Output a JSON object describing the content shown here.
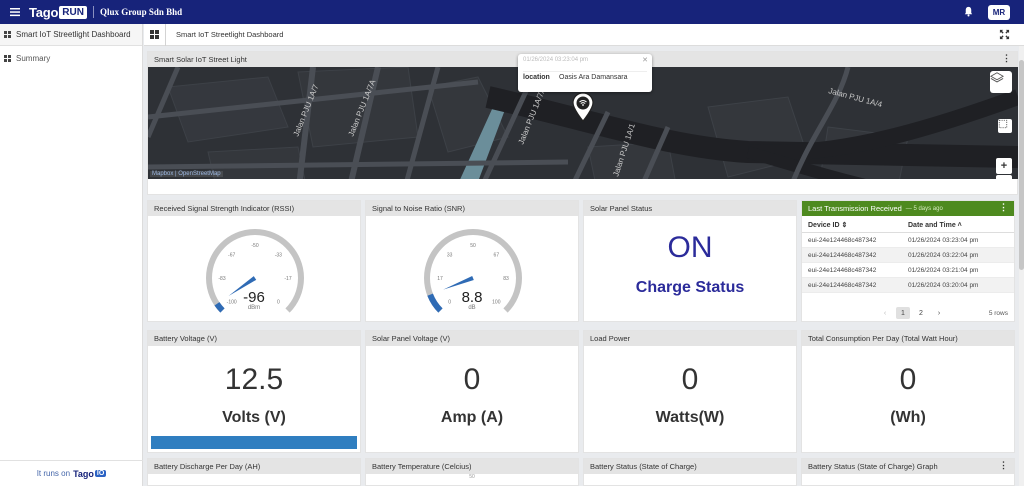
{
  "topbar": {
    "brand": "Tago",
    "brand_badge": "RUN",
    "company": "Qlux Group Sdn Bhd",
    "user_initials": "MR"
  },
  "sidebar": {
    "header": "Smart IoT Streetlight Dashboard",
    "items": [
      {
        "label": "Summary"
      }
    ],
    "footer_text": "It runs on",
    "footer_brand": "Tago",
    "footer_badge": "IO"
  },
  "dashboard": {
    "title": "Smart IoT Streetlight Dashboard"
  },
  "map_widget": {
    "title": "Smart Solar IoT Street Light",
    "popup": {
      "timestamp": "01/26/2024 03:23:04 pm",
      "key": "location",
      "value": "Oasis Ara Damansara"
    },
    "attribution_a": "Mapbox",
    "attribution_sep": "|",
    "attribution_b": "OpenStreetMap",
    "zoom_in": "+",
    "zoom_out": "−",
    "street_labels": [
      "Jalan PJU 1A/7",
      "Jalan PJU 1A/7A",
      "Jalan PJU 1A/7A",
      "Jalan PJU 1A/1",
      "Jalan PJU 1A/4"
    ]
  },
  "rssi": {
    "title": "Received Signal Strength Indicator (RSSI)",
    "value": "-96",
    "unit": "dBm",
    "min": -100,
    "max": 0,
    "current": -96,
    "ticks": [
      "-100",
      "-83",
      "-67",
      "-50",
      "-33",
      "-17",
      "0"
    ]
  },
  "snr": {
    "title": "Signal to Noise Ratio (SNR)",
    "value": "8.8",
    "unit": "dB",
    "min": 0,
    "max": 100,
    "current": 8.8,
    "ticks": [
      "0",
      "17",
      "33",
      "50",
      "67",
      "83",
      "100"
    ]
  },
  "solar_status": {
    "title": "Solar Panel Status",
    "state": "ON",
    "label": "Charge Status"
  },
  "last_tx": {
    "title": "Last Transmission Received",
    "since": "— 5 days ago",
    "col_device": "Device ID ⇕",
    "col_time": "Date and Time ˄",
    "rows": [
      {
        "device": "eui-24e124468c487342",
        "time": "01/26/2024 03:23:04 pm"
      },
      {
        "device": "eui-24e124468c487342",
        "time": "01/26/2024 03:22:04 pm"
      },
      {
        "device": "eui-24e124468c487342",
        "time": "01/26/2024 03:21:04 pm"
      },
      {
        "device": "eui-24e124468c487342",
        "time": "01/26/2024 03:20:04 pm"
      }
    ],
    "prev": "‹",
    "page1": "1",
    "page2": "2",
    "next": "›",
    "rows_count": "5 rows"
  },
  "battery_voltage": {
    "title": "Battery Voltage (V)",
    "value": "12.5",
    "unit": "Volts (V)"
  },
  "panel_voltage": {
    "title": "Solar Panel Voltage (V)",
    "value": "0",
    "unit": "Amp (A)"
  },
  "load_power": {
    "title": "Load Power",
    "value": "0",
    "unit": "Watts(W)"
  },
  "total_consumption": {
    "title": "Total Consumption Per Day (Total Watt Hour)",
    "value": "0",
    "unit": "(Wh)"
  },
  "bottom_row": {
    "discharge": "Battery Discharge Per Day (AH)",
    "temperature": "Battery Temperature (Celcius)",
    "soc": "Battery Status (State of Charge)",
    "soc_graph": "Battery Status (State of Charge) Graph",
    "temperature_tick": "50"
  },
  "colors": {
    "topbar": "#17237a",
    "gauge_fill": "#2f6bb5",
    "status_text": "#2b2b9a",
    "table_header": "#4e8a1f",
    "bar": "#2f7ec0"
  }
}
